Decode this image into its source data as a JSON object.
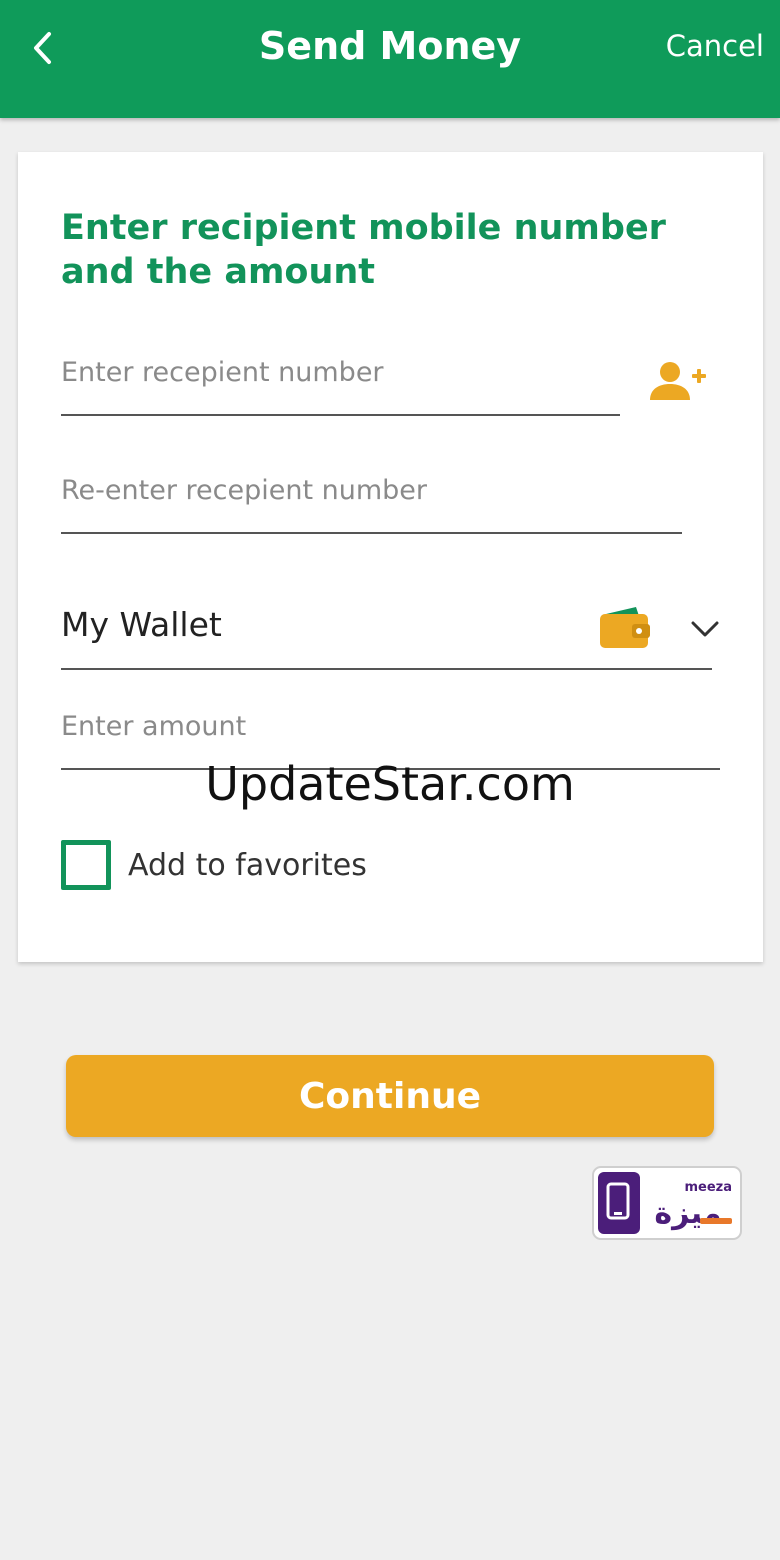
{
  "header": {
    "title": "Send Money",
    "cancel_label": "Cancel",
    "background_color": "#0f9b5a"
  },
  "form": {
    "heading": "Enter recipient mobile number and the amount",
    "recipient_placeholder": "Enter recepient number",
    "reenter_placeholder": "Re-enter recepient number",
    "wallet_selected": "My Wallet",
    "amount_placeholder": "Enter amount",
    "favorites_label": "Add to favorites",
    "favorites_checked": false,
    "accent_color": "#12935a"
  },
  "actions": {
    "continue_label": "Continue",
    "continue_color": "#eca823"
  },
  "brand": {
    "meeza_latin": "meeza",
    "meeza_arabic": "ميزة"
  },
  "watermark": "UpdateStar.com",
  "icons": {
    "back": "chevron-left-icon",
    "add_contact": "add-person-icon",
    "wallet": "wallet-icon",
    "dropdown": "chevron-down-icon"
  }
}
